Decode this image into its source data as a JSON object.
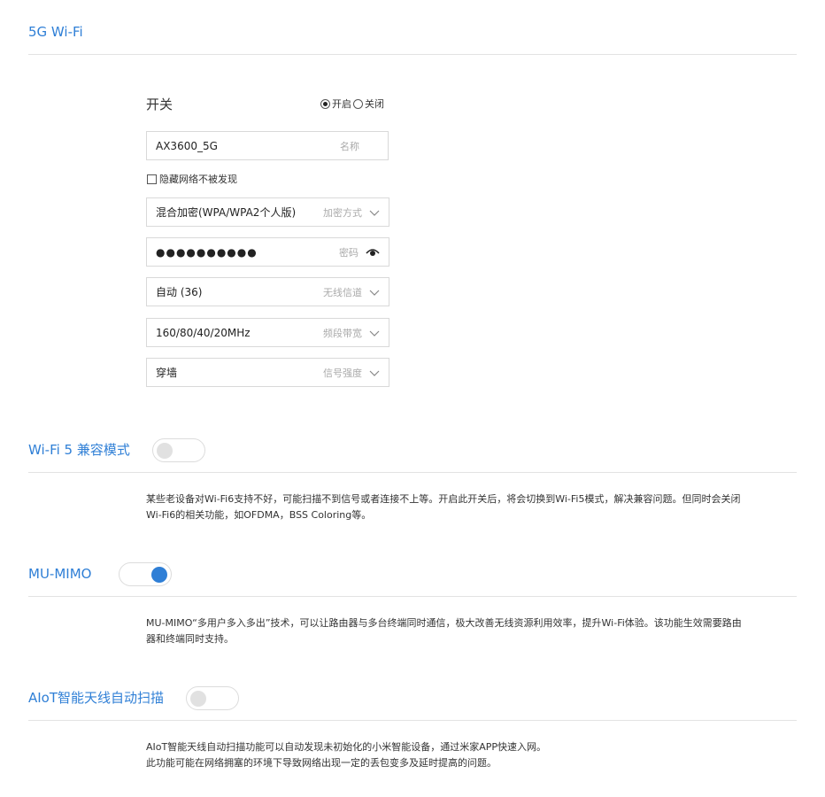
{
  "wifi5g": {
    "title": "5G Wi-Fi",
    "switch_label": "开关",
    "radio_on": "开启",
    "radio_off": "关闭",
    "radio_selected": "开启",
    "name_value": "AX3600_5G",
    "name_placeholder": "名称",
    "hide_network_label": "隐藏网络不被发现",
    "hide_network_checked": false,
    "encryption_value": "混合加密(WPA/WPA2个人版)",
    "encryption_label": "加密方式",
    "password_value": "●●●●●●●●●●",
    "password_label": "密码",
    "channel_value": "自动 (36)",
    "channel_label": "无线信道",
    "bandwidth_value": "160/80/40/20MHz",
    "bandwidth_label": "频段带宽",
    "signal_value": "穿墙",
    "signal_label": "信号强度"
  },
  "wifi5_compat": {
    "title": "Wi-Fi 5 兼容模式",
    "enabled": false,
    "desc_line1": "某些老设备对Wi-Fi6支持不好，可能扫描不到信号或者连接不上等。开启此开关后，将会切换到Wi-Fi5模式，解决兼容问题。但同时会关闭",
    "desc_line2": "Wi-Fi6的相关功能，如OFDMA，BSS Coloring等。"
  },
  "mumimo": {
    "title": "MU-MIMO",
    "enabled": true,
    "desc_line1": "MU-MIMO“多用户多入多出”技术，可以让路由器与多台终端同时通信，极大改善无线资源利用效率，提升Wi-Fi体验。该功能生效需要路由",
    "desc_line2": "器和终端同时支持。"
  },
  "aiot": {
    "title": "AIoT智能天线自动扫描",
    "enabled": false,
    "desc_line1": "AIoT智能天线自动扫描功能可以自动发现未初始化的小米智能设备，通过米家APP快速入网。",
    "desc_line2": "此功能可能在网络拥塞的环境下导致网络出现一定的丢包变多及延时提高的问题。"
  },
  "colors": {
    "accent": "#2f7fd6",
    "border": "#d9d9d9",
    "divider": "#e3e3e3"
  }
}
